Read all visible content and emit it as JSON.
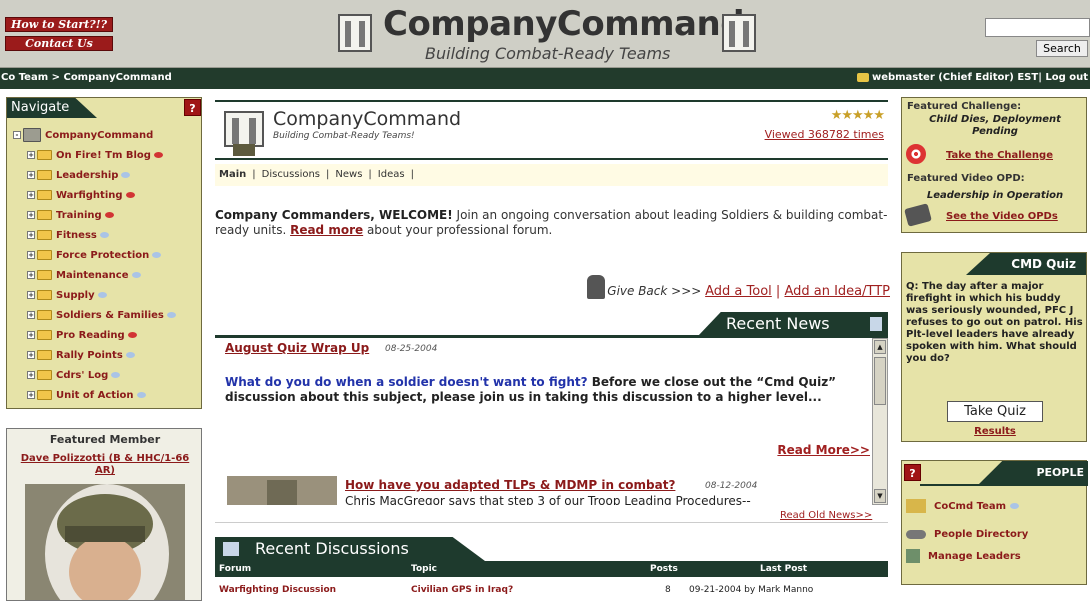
{
  "header": {
    "howto": "How to Start?!?",
    "contact": "Contact Us",
    "title": "CompanyCommand",
    "subtitle": "Building Combat-Ready Teams",
    "search_btn": "Search"
  },
  "topbar": {
    "breadcrumb": "Co Team > CompanyCommand",
    "user": "webmaster (Chief Editor) EST| Log out"
  },
  "nav": {
    "title": "Navigate",
    "help": "?",
    "root": "CompanyCommand",
    "items": [
      {
        "label": "On Fire! Tm Blog",
        "bubble": "red"
      },
      {
        "label": "Leadership",
        "bubble": "blue"
      },
      {
        "label": "Warfighting",
        "bubble": "red"
      },
      {
        "label": "Training",
        "bubble": "red"
      },
      {
        "label": "Fitness",
        "bubble": "blue"
      },
      {
        "label": "Force Protection",
        "bubble": "blue"
      },
      {
        "label": "Maintenance",
        "bubble": "blue"
      },
      {
        "label": "Supply",
        "bubble": "blue"
      },
      {
        "label": "Soldiers & Families",
        "bubble": "blue"
      },
      {
        "label": "Pro Reading",
        "bubble": "red"
      },
      {
        "label": "Rally Points",
        "bubble": "blue"
      },
      {
        "label": "Cdrs' Log",
        "bubble": "blue"
      },
      {
        "label": "Unit of Action",
        "bubble": "blue"
      }
    ]
  },
  "featured_member": {
    "title": "Featured Member",
    "name": "Dave Polizzotti (B & HHC/1-66 AR)"
  },
  "main": {
    "title": "CompanyCommand",
    "subtitle": "Building Combat-Ready Teams!",
    "stars": "★★★★★",
    "viewed": "Viewed 368782 times",
    "tabs": [
      "Main",
      "Discussions",
      "News",
      "Ideas"
    ],
    "welcome_bold": "Company Commanders, WELCOME!",
    "welcome_text": " Join an ongoing conversation about leading Soldiers & building combat-ready units. ",
    "read_more": "Read more",
    "welcome_tail": " about your professional forum.",
    "give_back": "Give Back >>> ",
    "add_tool": "Add a Tool",
    "pipe": " | ",
    "add_idea": "Add an Idea/TTP"
  },
  "news": {
    "title": "Recent News",
    "item1_title": "August Quiz Wrap Up",
    "item1_date": "08-25-2004",
    "item1_question": "What do you do when a soldier doesn't want to fight?",
    "item1_body": "  Before we close out the “Cmd Quiz” discussion about this subject, please join us in taking this discussion to a higher level...",
    "item1_more": "Read More>>",
    "item2_title": "How have you adapted TLPs & MDMP in combat?",
    "item2_date": "08-12-2004",
    "item2_body": "Chris MacGregor says that step 3 of our Troop Leading Procedures--",
    "read_old": "Read Old News>>"
  },
  "discussions": {
    "title": "Recent Discussions",
    "columns": {
      "forum": "Forum",
      "topic": "Topic",
      "posts": "Posts",
      "last": "Last Post"
    },
    "row": {
      "forum": "Warfighting Discussion",
      "topic": "Civilian GPS in Iraq?",
      "posts": "8",
      "last": "09-21-2004 by Mark Manno"
    }
  },
  "featured": {
    "challenge_label": "Featured Challenge:",
    "challenge_value": "Child Dies, Deployment Pending",
    "challenge_action": "Take the Challenge",
    "video_label": "Featured Video OPD:",
    "video_value": "Leadership in Operation",
    "video_action": "See the Video OPDs"
  },
  "quiz": {
    "title": "CMD Quiz",
    "text": "Q: The day after a major firefight in which his buddy was seriously wounded, PFC J refuses to go out on patrol. His Plt-level leaders have already spoken with him. What should you do?",
    "button": "Take Quiz",
    "results": "Results"
  },
  "people": {
    "help": "?",
    "title": "PEOPLE",
    "items": [
      "CoCmd Team",
      "People Directory",
      "Manage Leaders"
    ]
  }
}
